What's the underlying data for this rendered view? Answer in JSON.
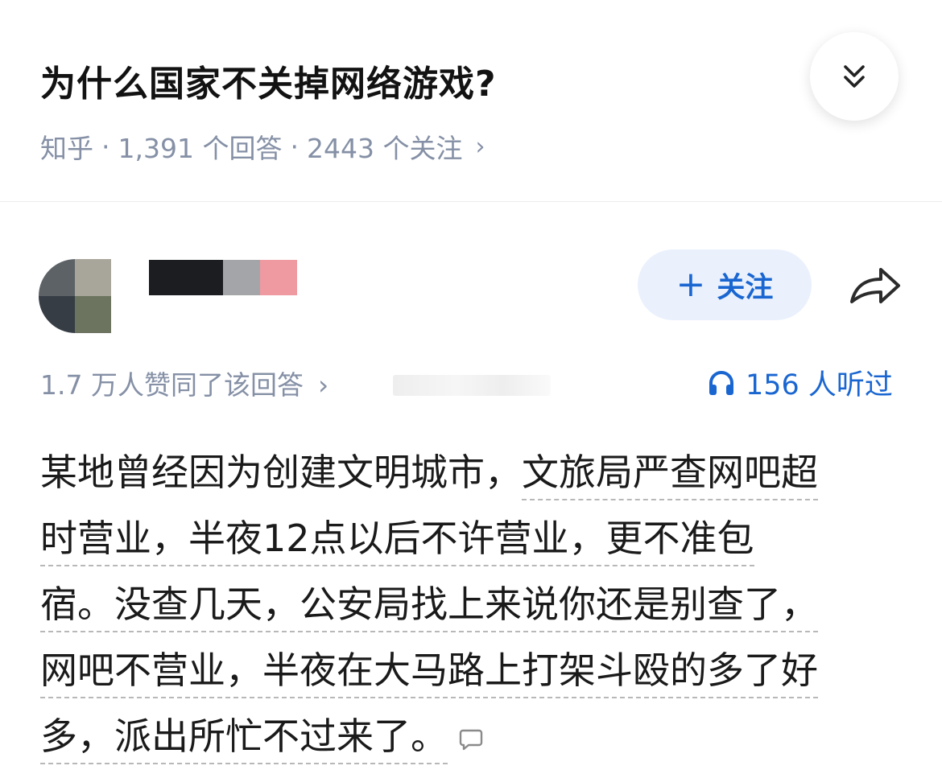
{
  "question": {
    "title": "为什么国家不关掉网络游戏?",
    "source": "知乎",
    "answers": "1,391 个回答",
    "follows": "2443 个关注",
    "separator": "·",
    "chevron": "›"
  },
  "author": {
    "avatar_colors": [
      "#5c6266",
      "#a8a59a",
      "#363d45",
      "#6c7460"
    ],
    "name_block_colors": [
      "#1c1d21",
      "#a4a5a9",
      "#ef99a1"
    ],
    "follow_label": "关注",
    "follow_plus": "+"
  },
  "stats": {
    "approvals": "1.7 万人赞同了该回答",
    "chevron": "›",
    "listens": "156 人听过"
  },
  "answer": {
    "lines": [
      {
        "plain": "某地曾经因为创建文明城市，",
        "underlined": "文旅局严查网吧超"
      },
      {
        "plain": "",
        "underlined": "时营业，半夜12点以后不许营业，更不准包"
      },
      {
        "plain": "",
        "underlined": "宿。没查几天，公安局找上来说你还是别查了，"
      },
      {
        "plain": "",
        "underlined": "网吧不营业，半夜在大马路上打架斗殴的多了好"
      },
      {
        "plain": "",
        "underlined": "多，派出所忙不过来了。"
      }
    ]
  },
  "colors": {
    "accent": "#1a66d1",
    "follow_bg": "#eaf1fd",
    "meta_text": "#8590a6",
    "underline": "#b8b8b8"
  },
  "icons": [
    "chevron-double-down-icon",
    "share-icon",
    "headphones-icon",
    "comment-icon"
  ]
}
